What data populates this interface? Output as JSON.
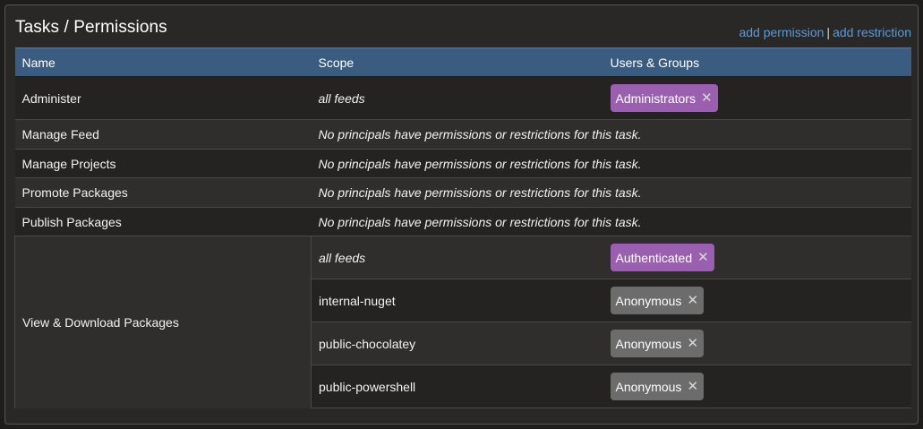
{
  "panel": {
    "title": "Tasks / Permissions",
    "add_permission": "add permission",
    "separator": "|",
    "add_restriction": "add restriction"
  },
  "table": {
    "headers": [
      "Name",
      "Scope",
      "Users & Groups"
    ],
    "rows": [
      {
        "name": "Administer",
        "scope": "all feeds",
        "principal": "Administrators",
        "principal_color": "#9b5fb0"
      },
      {
        "name": "Manage Feed",
        "message": "No principals have permissions or restrictions for this task."
      },
      {
        "name": "Manage Projects",
        "message": "No principals have permissions or restrictions for this task."
      },
      {
        "name": "Promote Packages",
        "message": "No principals have permissions or restrictions for this task."
      },
      {
        "name": "Publish Packages",
        "message": "No principals have permissions or restrictions for this task."
      }
    ],
    "group": {
      "name": "View & Download Packages",
      "entries": [
        {
          "scope": "all feeds",
          "principal": "Authenticated",
          "principal_color": "#9b5fb0"
        },
        {
          "scope": "internal-nuget",
          "principal": "Anonymous",
          "principal_color": "#6c6c6c"
        },
        {
          "scope": "public-chocolatey",
          "principal": "Anonymous",
          "principal_color": "#6c6c6c"
        },
        {
          "scope": "public-powershell",
          "principal": "Anonymous",
          "principal_color": "#6c6c6c"
        }
      ]
    },
    "remove_icon": "close-icon",
    "remove_glyph": "✕"
  },
  "colors": {
    "header_bg": "#3a5c80",
    "link": "#5c9ad6",
    "panel_bg": "#2a2826"
  }
}
